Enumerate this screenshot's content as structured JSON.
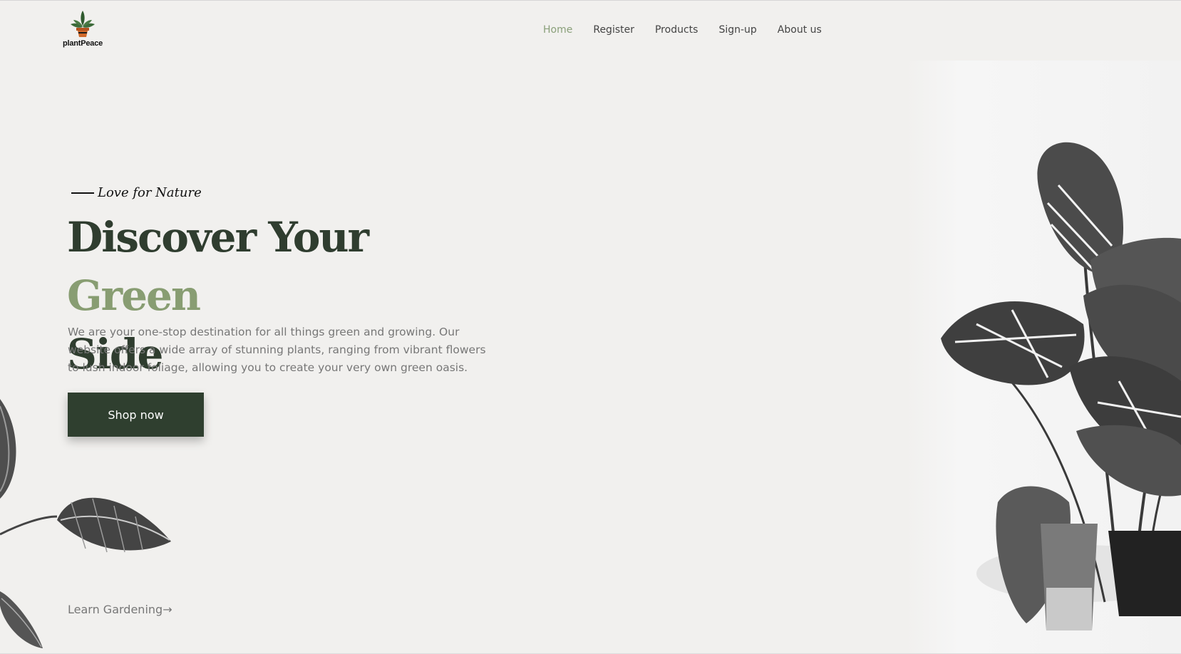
{
  "brand": {
    "name": "plantPeace",
    "accent": "#889d72",
    "dark": "#2f3f2f"
  },
  "nav": {
    "items": [
      {
        "label": "Home",
        "active": true
      },
      {
        "label": "Register",
        "active": false
      },
      {
        "label": "Products",
        "active": false
      },
      {
        "label": "Sign-up",
        "active": false
      },
      {
        "label": "About us",
        "active": false
      }
    ]
  },
  "hero": {
    "eyebrow": "Love for Nature",
    "headline_part1": "Discover Your ",
    "headline_accent": "Green",
    "headline_part2": "Side",
    "description": "We are your one-stop destination for all things green and growing. Our website offers a wide array of stunning plants, ranging from vibrant flowers to lush indoor foliage, allowing you to create your very own green oasis.",
    "cta_label": "Shop now",
    "learn_link": "Learn Gardening→"
  },
  "icons": {
    "logo": "plant-pot-icon",
    "right_image": "monstera-plant-image",
    "left_image": "leaves-image"
  }
}
